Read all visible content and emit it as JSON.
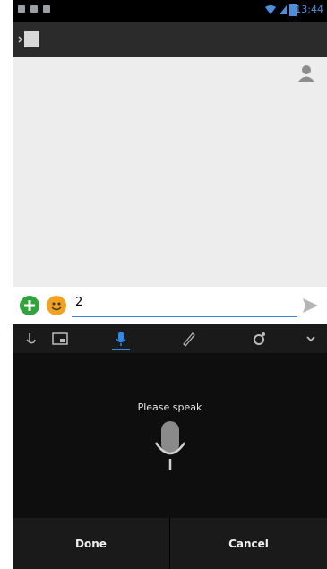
{
  "status_bar": {
    "time": "13:44"
  },
  "compose": {
    "input_value": "2"
  },
  "voice": {
    "prompt": "Please speak"
  },
  "buttons": {
    "done": "Done",
    "cancel": "Cancel"
  },
  "colors": {
    "accent": "#2e8ae6",
    "add_green": "#2fa43a",
    "emoji_orange": "#f3a21e"
  },
  "icons": {
    "status": [
      "notification-icon",
      "notification-icon",
      "notification-icon",
      "wifi-icon",
      "signal-icon",
      "battery-icon"
    ],
    "keyboard_header": [
      "touch-icon",
      "layout-icon",
      "mic-icon",
      "pen-icon",
      "settings-icon",
      "collapse-icon"
    ]
  }
}
